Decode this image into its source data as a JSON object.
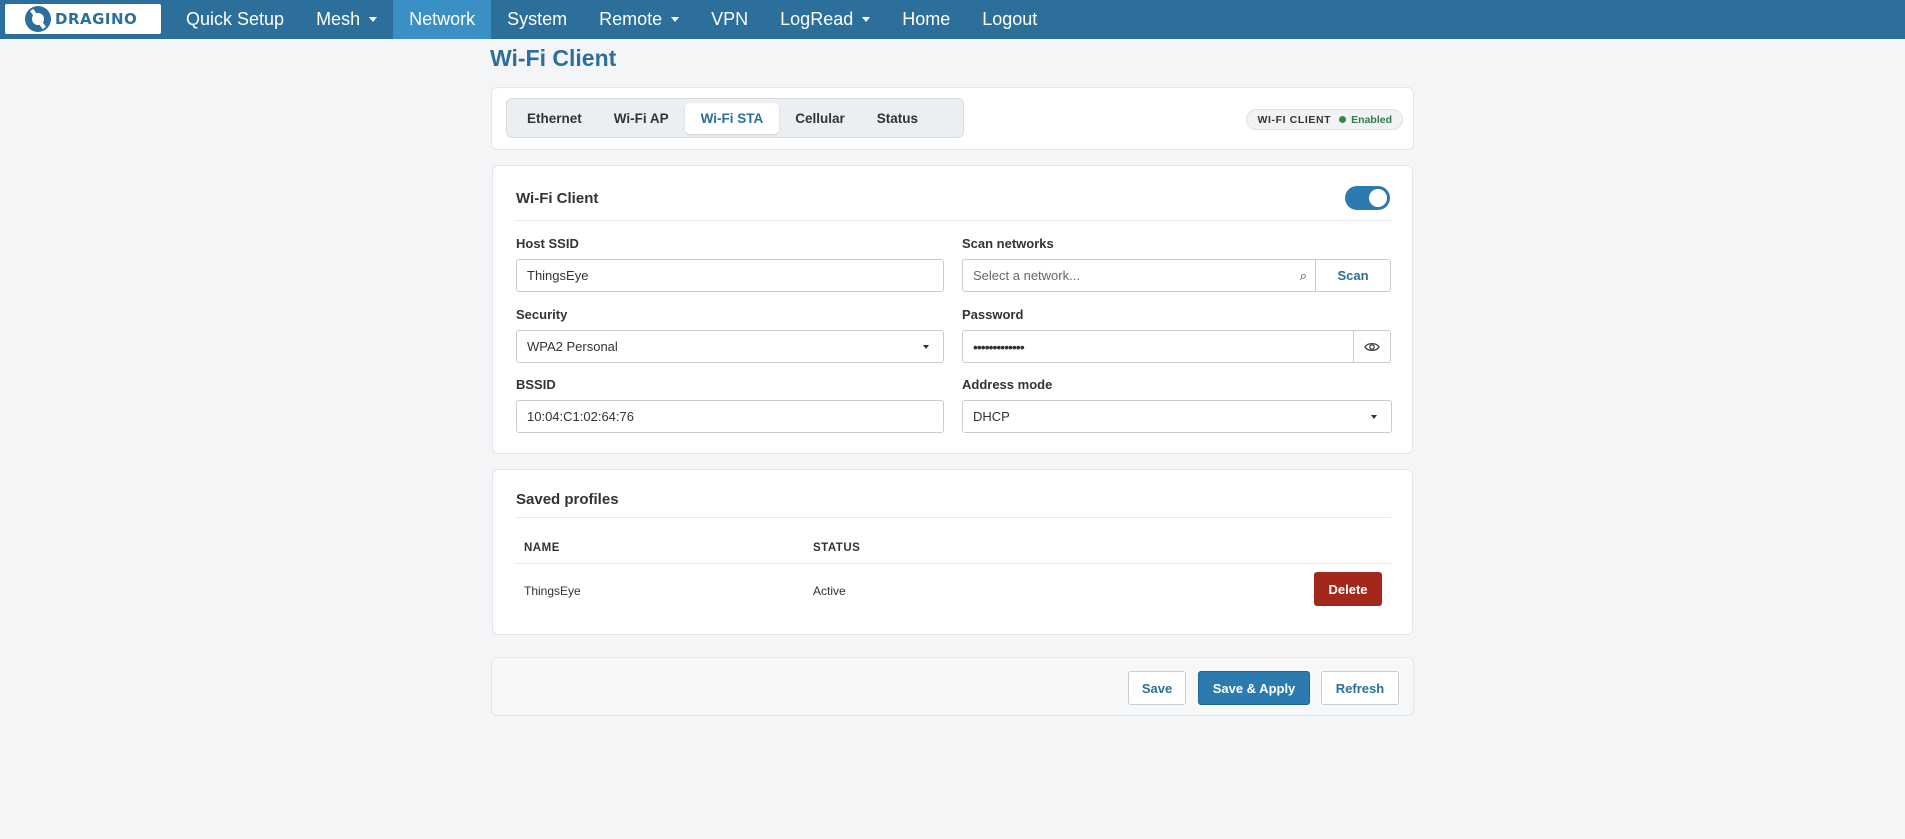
{
  "app": {
    "brand": "DRAGINO",
    "page_title": "Wi-Fi Client"
  },
  "nav": {
    "items": [
      {
        "label": "Quick Setup",
        "dropdown": false,
        "active": false
      },
      {
        "label": "Mesh",
        "dropdown": true,
        "active": false
      },
      {
        "label": "Network",
        "dropdown": false,
        "active": true
      },
      {
        "label": "System",
        "dropdown": false,
        "active": false
      },
      {
        "label": "Remote",
        "dropdown": true,
        "active": false
      },
      {
        "label": "VPN",
        "dropdown": false,
        "active": false
      },
      {
        "label": "LogRead",
        "dropdown": true,
        "active": false
      },
      {
        "label": "Home",
        "dropdown": false,
        "active": false
      },
      {
        "label": "Logout",
        "dropdown": false,
        "active": false
      }
    ]
  },
  "tabs": {
    "items": [
      "Ethernet",
      "Wi-Fi AP",
      "Wi-Fi STA",
      "Cellular",
      "Status"
    ],
    "active": "Wi-Fi STA"
  },
  "status_pill": {
    "label": "WI-FI CLIENT",
    "value": "Enabled",
    "color": "#2e8b4a"
  },
  "wifi_client": {
    "title": "Wi-Fi Client",
    "enabled": true,
    "host_ssid": {
      "label": "Host SSID",
      "value": "ThingsEye"
    },
    "scan": {
      "label": "Scan networks",
      "placeholder": "Select a network...",
      "button": "Scan"
    },
    "security": {
      "label": "Security",
      "value": "WPA2 Personal"
    },
    "password": {
      "label": "Password",
      "value": "•••••••••••••"
    },
    "bssid": {
      "label": "BSSID",
      "value": "10:04:C1:02:64:76"
    },
    "address_mode": {
      "label": "Address mode",
      "value": "DHCP"
    }
  },
  "saved_profiles": {
    "title": "Saved profiles",
    "columns": [
      "NAME",
      "STATUS"
    ],
    "rows": [
      {
        "name": "ThingsEye",
        "status": "Active",
        "action": "Delete"
      }
    ]
  },
  "footer": {
    "save": "Save",
    "save_apply": "Save & Apply",
    "refresh": "Refresh"
  },
  "colors": {
    "nav_bg": "#2b6f9a",
    "nav_active": "#3a8fc4",
    "accent": "#2b7bb0",
    "danger": "#a4271c"
  },
  "icons": {
    "brand": "dragino-logo-icon",
    "search": "search-icon",
    "password_toggle": "eye-icon"
  }
}
